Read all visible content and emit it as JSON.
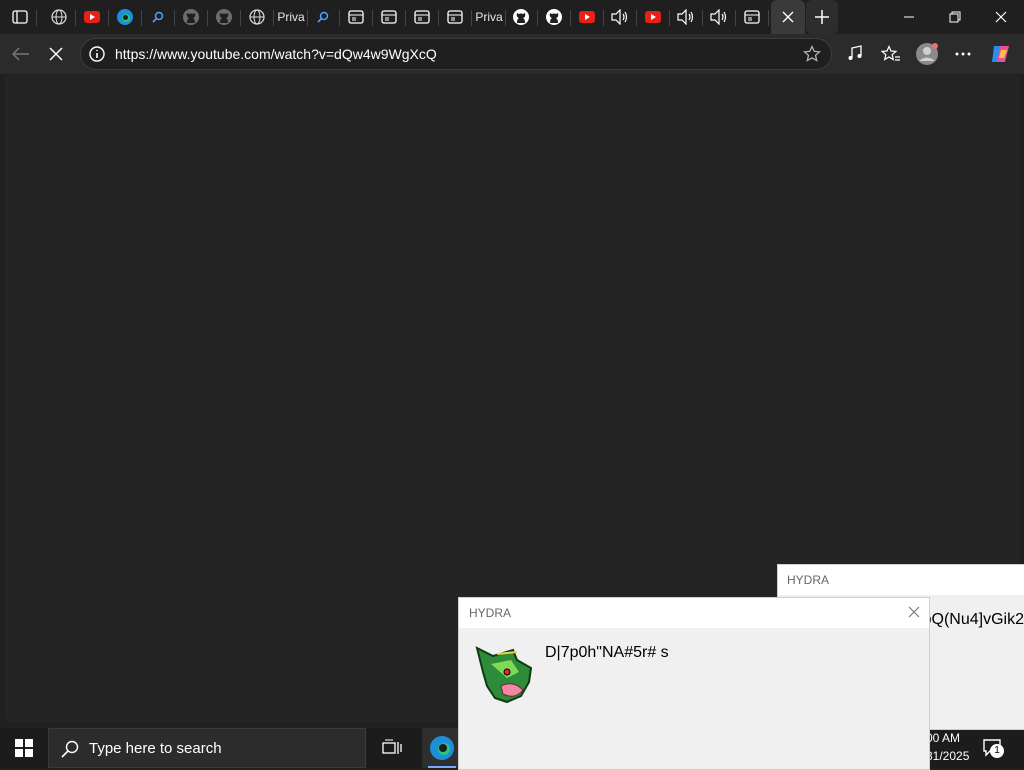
{
  "browser": {
    "tabs": [
      {
        "icon": "tab-actions-icon"
      },
      {
        "icon": "globe-icon"
      },
      {
        "icon": "youtube-icon"
      },
      {
        "icon": "edge-icon"
      },
      {
        "icon": "search-icon"
      },
      {
        "icon": "github-icon"
      },
      {
        "icon": "github-icon"
      },
      {
        "icon": "globe-icon"
      },
      {
        "icon": "text",
        "label": "Priva"
      },
      {
        "icon": "search-icon"
      },
      {
        "icon": "page-icon"
      },
      {
        "icon": "page-icon"
      },
      {
        "icon": "page-icon"
      },
      {
        "icon": "page-icon"
      },
      {
        "icon": "text",
        "label": "Priva"
      },
      {
        "icon": "github-icon"
      },
      {
        "icon": "github-icon"
      },
      {
        "icon": "youtube-icon"
      },
      {
        "icon": "speaker-icon"
      },
      {
        "icon": "youtube-icon"
      },
      {
        "icon": "speaker-icon"
      },
      {
        "icon": "speaker-icon"
      },
      {
        "icon": "page-icon"
      }
    ],
    "url": "https://www.youtube.com/watch?v=dQw4w9WgXcQ"
  },
  "taskbar": {
    "search_placeholder": "Type here to search",
    "time": "00 AM",
    "date": "31/2025",
    "notification_count": "1"
  },
  "dialogs": [
    {
      "title": "HYDRA",
      "message": "pQ(Nu4]vGik2"
    },
    {
      "title": "HYDRA",
      "message": "D|7p0h\"NA#5r# s"
    }
  ]
}
